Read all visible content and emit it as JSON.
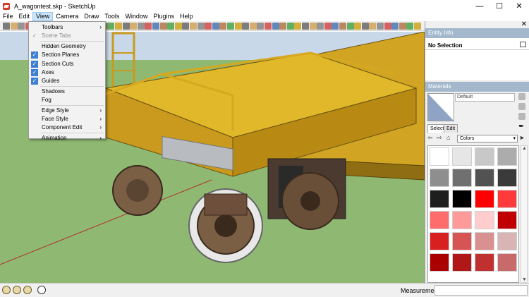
{
  "window": {
    "title": "A_wagontest.skp - SketchUp"
  },
  "menubar": [
    "File",
    "Edit",
    "View",
    "Camera",
    "Draw",
    "Tools",
    "Window",
    "Plugins",
    "Help"
  ],
  "view_menu": {
    "items": [
      {
        "label": "Toolbars",
        "checked": false,
        "submenu": true,
        "disabled": false
      },
      {
        "label": "Scene Tabs",
        "checked": true,
        "submenu": false,
        "disabled": true
      },
      {
        "label": "Hidden Geometry",
        "checked": false,
        "submenu": false,
        "disabled": false
      },
      {
        "label": "Section Planes",
        "checked": true,
        "submenu": false,
        "disabled": false
      },
      {
        "label": "Section Cuts",
        "checked": true,
        "submenu": false,
        "disabled": false
      },
      {
        "label": "Axes",
        "checked": true,
        "submenu": false,
        "disabled": false
      },
      {
        "label": "Guides",
        "checked": true,
        "submenu": false,
        "disabled": false
      },
      {
        "label": "Shadows",
        "checked": false,
        "submenu": false,
        "disabled": false
      },
      {
        "label": "Fog",
        "checked": false,
        "submenu": false,
        "disabled": false
      },
      {
        "label": "Edge Style",
        "checked": false,
        "submenu": true,
        "disabled": false
      },
      {
        "label": "Face Style",
        "checked": false,
        "submenu": true,
        "disabled": false
      },
      {
        "label": "Component Edit",
        "checked": false,
        "submenu": true,
        "disabled": false
      },
      {
        "label": "Animation",
        "checked": false,
        "submenu": true,
        "disabled": false
      }
    ]
  },
  "entity_info": {
    "header": "Entity Info",
    "selection": "No Selection"
  },
  "materials": {
    "header": "Materials",
    "current_material": "Default",
    "tabs": [
      "Select",
      "Edit"
    ],
    "collection": "Colors",
    "swatches": [
      "#ffffff",
      "#e6e6e6",
      "#c8c8c8",
      "#acacac",
      "#8e8e8e",
      "#707070",
      "#525252",
      "#3a3a3a",
      "#1e1e1e",
      "#000000",
      "#ff0000",
      "#ff3a3a",
      "#ff6c6c",
      "#ff9a9a",
      "#ffcdcd",
      "#c00000",
      "#d82020",
      "#d65454",
      "#d99090",
      "#d9b4b4",
      "#aa0000",
      "#b01818",
      "#c03030",
      "#c86a6a"
    ]
  },
  "status": {
    "measurements_label": "Measurements",
    "measurements_value": ""
  },
  "toolbar_icons": [
    "select-icon",
    "eraser-icon",
    "paint-icon",
    "move-icon",
    "rotate-icon",
    "orbit-icon",
    "zoom-icon",
    "section-icon"
  ]
}
